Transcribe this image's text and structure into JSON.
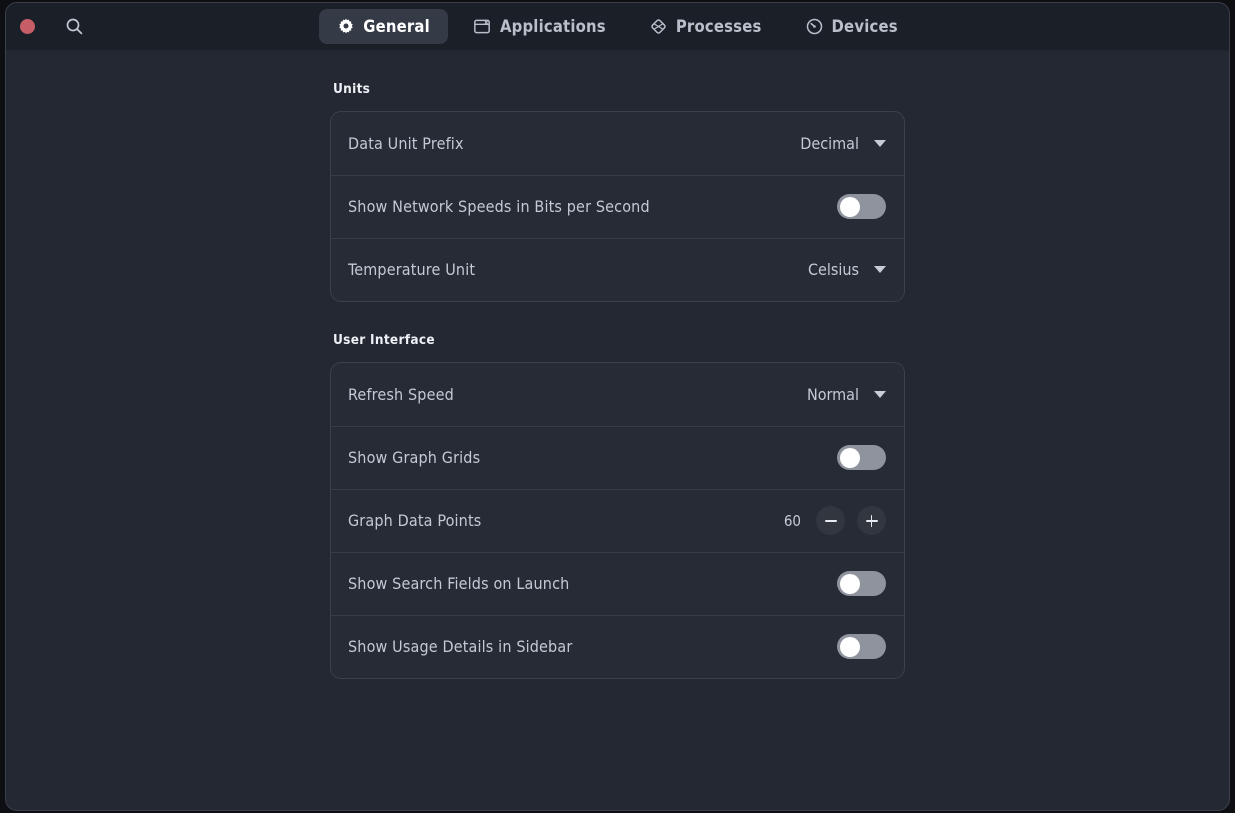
{
  "window": {
    "close_button": "close-window",
    "search_button": "search"
  },
  "tabs": [
    {
      "label": "General",
      "icon": "gear-icon",
      "active": true
    },
    {
      "label": "Applications",
      "icon": "window-icon",
      "active": false
    },
    {
      "label": "Processes",
      "icon": "gem-icon",
      "active": false
    },
    {
      "label": "Devices",
      "icon": "speedometer-icon",
      "active": false
    }
  ],
  "sections": [
    {
      "title": "Units",
      "rows": [
        {
          "label": "Data Unit Prefix",
          "control": "dropdown",
          "value": "Decimal"
        },
        {
          "label": "Show Network Speeds in Bits per Second",
          "control": "toggle",
          "value": "off"
        },
        {
          "label": "Temperature Unit",
          "control": "dropdown",
          "value": "Celsius"
        }
      ]
    },
    {
      "title": "User Interface",
      "rows": [
        {
          "label": "Refresh Speed",
          "control": "dropdown",
          "value": "Normal"
        },
        {
          "label": "Show Graph Grids",
          "control": "toggle",
          "value": "off"
        },
        {
          "label": "Graph Data Points",
          "control": "stepper",
          "value": "60",
          "decrement_label": "minus",
          "increment_label": "plus"
        },
        {
          "label": "Show Search Fields on Launch",
          "control": "toggle",
          "value": "off"
        },
        {
          "label": "Show Usage Details in Sidebar",
          "control": "toggle",
          "value": "off"
        }
      ]
    }
  ],
  "colors": {
    "window_bg": "#242832",
    "header_bg": "#1b1f27",
    "card_bg": "#262b35",
    "card_border": "#3b404c",
    "active_tab_bg": "#343a46",
    "close_red": "#c75d66",
    "toggle_off": "#8e939d",
    "toggle_on": "#4f84d6",
    "text_primary": "#eef1f6",
    "text_secondary": "#c4cad5"
  }
}
